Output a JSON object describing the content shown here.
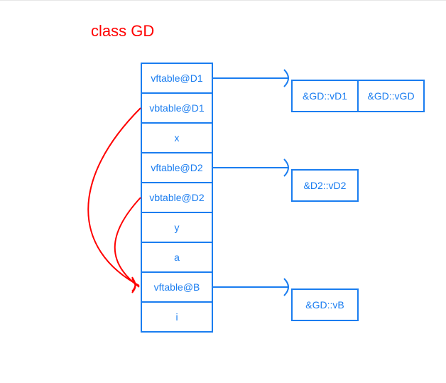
{
  "title": "class GD",
  "layout_cells": [
    {
      "id": "vftable-d1",
      "label": "vftable@D1"
    },
    {
      "id": "vbtable-d1",
      "label": "vbtable@D1"
    },
    {
      "id": "x",
      "label": "x"
    },
    {
      "id": "vftable-d2",
      "label": "vftable@D2"
    },
    {
      "id": "vbtable-d2",
      "label": "vbtable@D2"
    },
    {
      "id": "y",
      "label": "y"
    },
    {
      "id": "a",
      "label": "a"
    },
    {
      "id": "vftable-b",
      "label": "vftable@B"
    },
    {
      "id": "i",
      "label": "i"
    }
  ],
  "vftable_d1_entries": [
    {
      "id": "gd-vd1",
      "label": "&GD::vD1"
    },
    {
      "id": "gd-vgd",
      "label": "&GD::vGD"
    }
  ],
  "vftable_d2_entries": [
    {
      "id": "d2-vd2",
      "label": "&D2::vD2"
    }
  ],
  "vftable_b_entries": [
    {
      "id": "gd-vb",
      "label": "&GD::vB"
    }
  ],
  "colors": {
    "blue": "#1a7df0",
    "red": "#ff0000"
  }
}
